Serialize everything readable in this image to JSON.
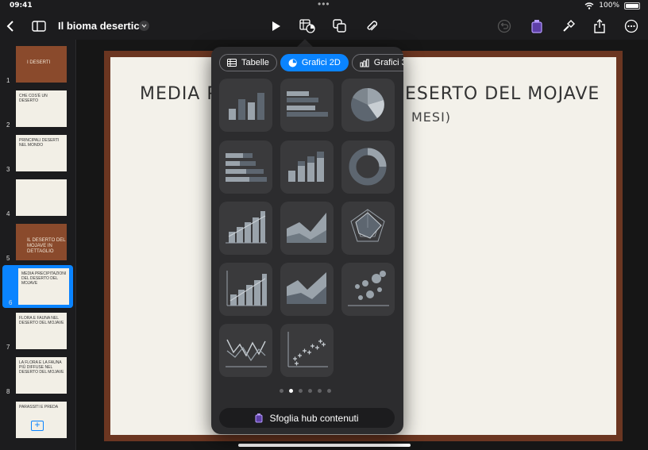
{
  "status_bar": {
    "time": "09:41",
    "battery_pct": "100%"
  },
  "toolbar": {
    "doc_title": "Il bioma desertico",
    "icons": [
      "back-chevron-icon",
      "sidebar-icon",
      "play-icon",
      "insert-chart-icon",
      "shapes-icon",
      "paperclip-icon",
      "undo-icon",
      "format-brush-icon",
      "share-icon",
      "more-icon"
    ]
  },
  "slides": [
    {
      "num": "1",
      "title": "I DESERTI",
      "dark": true
    },
    {
      "num": "2",
      "title": "CHE COS'È UN DESERTO",
      "dark": false
    },
    {
      "num": "3",
      "title": "PRINCIPALI DESERTI NEL MONDO",
      "dark": false
    },
    {
      "num": "4",
      "title": "",
      "dark": false
    },
    {
      "num": "5",
      "title": "IL DESERTO DEL MOJAVE IN DETTAGLIO",
      "dark": true
    },
    {
      "num": "6",
      "title": "MEDIA PRECIPITAZIONI DEL DESERTO DEL MOJAVE",
      "dark": false,
      "selected": true
    },
    {
      "num": "7",
      "title": "FLORA E FAUNA NEL DESERTO DEL MOJAVE",
      "dark": false
    },
    {
      "num": "8",
      "title": "LA FLORA E LA FAUNA PIÙ DIFFUSE NEL DESERTO DEL MOJAVE",
      "dark": false
    },
    {
      "num": "",
      "title": "PARASSITI E PREDA",
      "dark": false
    }
  ],
  "slide": {
    "title_left": "MEDIA P",
    "title_right": "ESERTO DEL MOJAVE",
    "subtitle": "MESI)"
  },
  "popover": {
    "tabs": [
      {
        "label": "Tabelle",
        "icon": "table-icon",
        "active": false
      },
      {
        "label": "Grafici 2D",
        "icon": "pie-chart-icon",
        "active": true
      },
      {
        "label": "Grafici 3",
        "icon": "bar-chart-3d-icon",
        "active": false
      }
    ],
    "chart_types": [
      "column-chart",
      "bar-chart",
      "pie-chart",
      "stacked-bar-chart",
      "stacked-column-chart",
      "donut-chart",
      "column-trend-chart",
      "area-chart",
      "radar-chart",
      "column-axis-chart",
      "stacked-area-chart",
      "bubble-chart",
      "line-chart",
      "scatter-chart"
    ],
    "page_count": 6,
    "current_page": 2,
    "hub_label": "Sfoglia hub contenuti"
  },
  "colors": {
    "accent": "#0a84ff",
    "slide_border": "#6b3621",
    "slide_bg": "#f3f1ea"
  }
}
